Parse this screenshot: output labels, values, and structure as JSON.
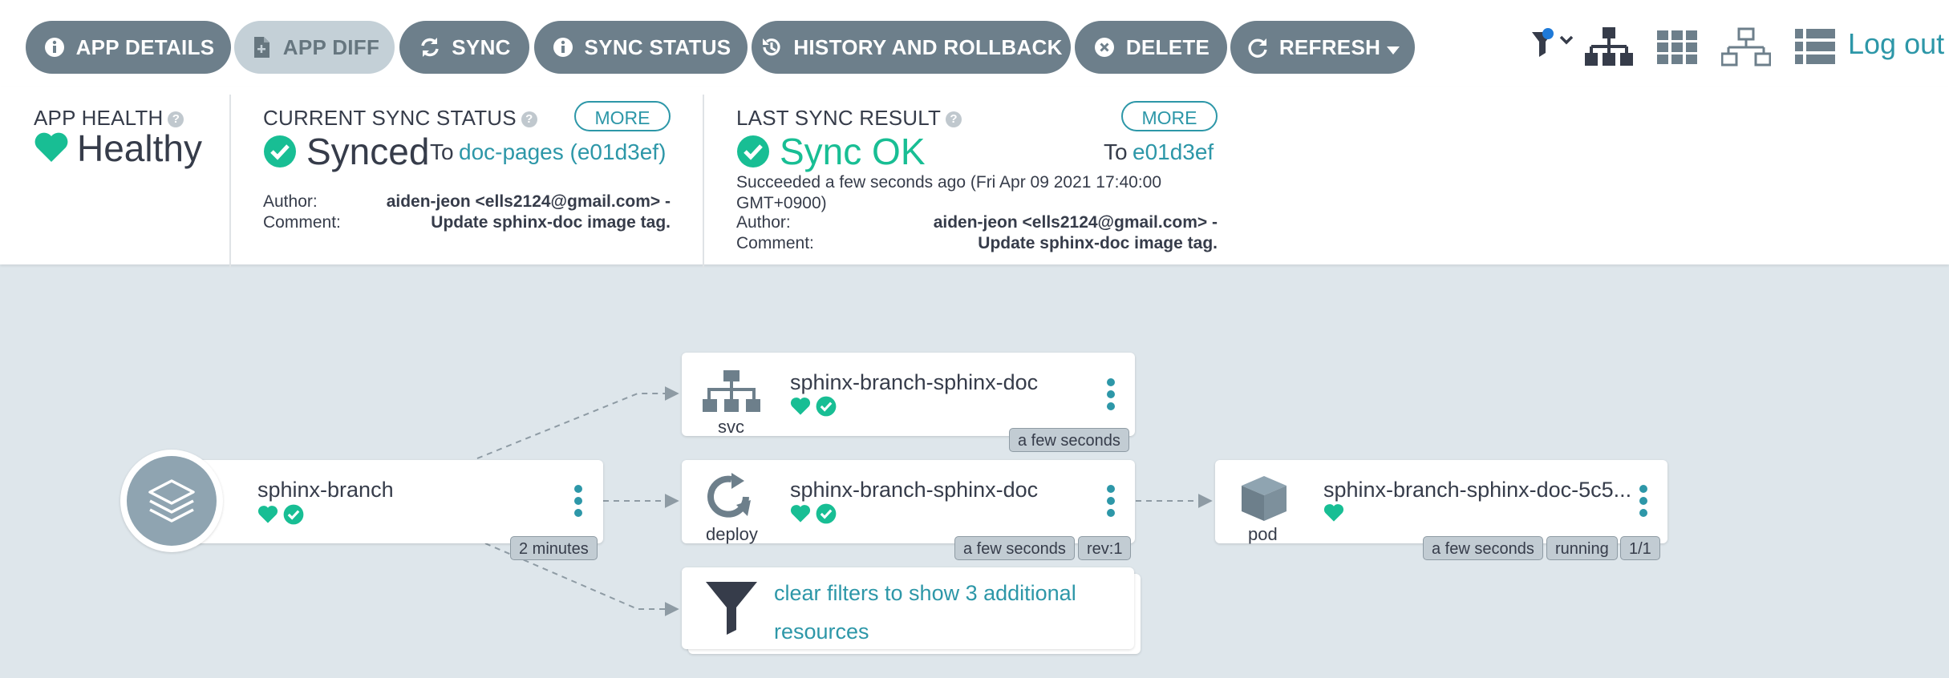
{
  "toolbar": {
    "app_details": "APP DETAILS",
    "app_diff": "APP DIFF",
    "sync": "SYNC",
    "sync_status": "SYNC STATUS",
    "history": "HISTORY AND ROLLBACK",
    "delete": "DELETE",
    "refresh": "REFRESH",
    "logout": "Log out"
  },
  "status": {
    "app_health_label": "APP HEALTH",
    "app_health_value": "Healthy",
    "current_sync_label": "CURRENT SYNC STATUS",
    "current_more": "MORE",
    "current_value": "Synced",
    "current_to_prefix": "To",
    "current_to_target": "doc-pages (e01d3ef)",
    "current_author_label": "Author:",
    "current_author_value": "aiden-jeon <ells2124@gmail.com> -",
    "current_comment_label": "Comment:",
    "current_comment_value": "Update sphinx-doc image tag.",
    "last_sync_label": "LAST SYNC RESULT",
    "last_more": "MORE",
    "last_value": "Sync OK",
    "last_to_prefix": "To",
    "last_to_target": "e01d3ef",
    "last_succeeded_line1": "Succeeded a few seconds ago (Fri Apr 09 2021 17:40:00",
    "last_succeeded_line2": "GMT+0900)",
    "last_author_label": "Author:",
    "last_author_value": "aiden-jeon <ells2124@gmail.com> -",
    "last_comment_label": "Comment:",
    "last_comment_value": "Update sphinx-doc image tag."
  },
  "graph": {
    "app": {
      "name": "sphinx-branch",
      "age": "2 minutes"
    },
    "svc": {
      "name": "sphinx-branch-sphinx-doc",
      "kind": "svc",
      "age": "a few seconds"
    },
    "deploy": {
      "name": "sphinx-branch-sphinx-doc",
      "kind": "deploy",
      "age": "a few seconds",
      "rev": "rev:1"
    },
    "pod": {
      "name": "sphinx-branch-sphinx-doc-5c5...",
      "kind": "pod",
      "age": "a few seconds",
      "state": "running",
      "ready": "1/1"
    },
    "filter": {
      "line1": "clear filters to show 3 additional",
      "line2": "resources"
    }
  },
  "colors": {
    "accent": "#2d97a8",
    "healthy": "#18be94",
    "button": "#6d7f8b",
    "background": "#dee6eb"
  }
}
